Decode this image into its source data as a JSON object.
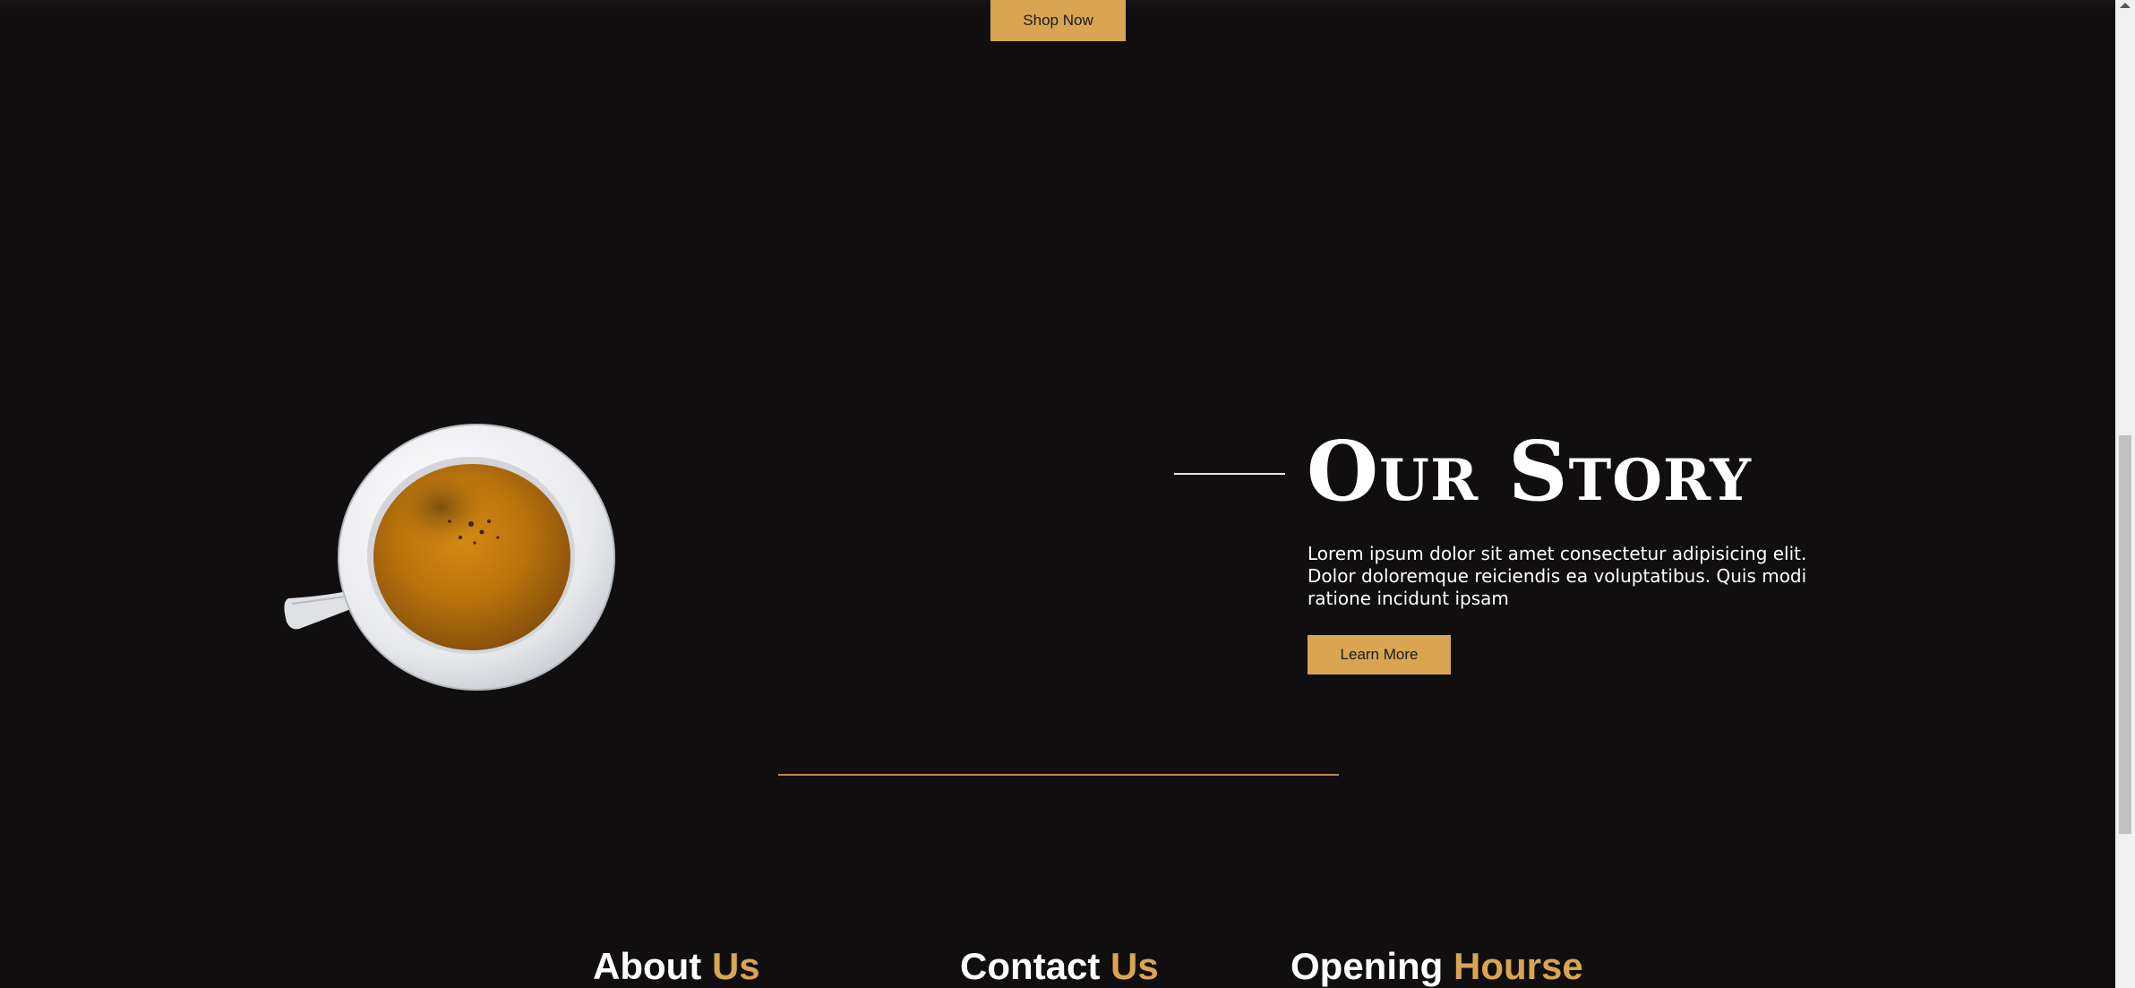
{
  "hero": {
    "shop_button_label": "Shop Now"
  },
  "story": {
    "image_alt": "coffee-cup-image",
    "title": "Our Story",
    "text": "Lorem ipsum dolor sit amet consectetur adipisicing elit. Dolor doloremque reiciendis ea voluptatibus. Quis modi ratione incidunt ipsam",
    "button_label": "Learn More"
  },
  "footer": {
    "about": {
      "main": "About",
      "accent": "Us"
    },
    "contact": {
      "main": "Contact",
      "accent": "Us"
    },
    "hours": {
      "main": "Opening",
      "accent": "Hourse"
    }
  },
  "colors": {
    "background": "#100e0f",
    "accent": "#d9a552",
    "text": "#ffffff"
  }
}
